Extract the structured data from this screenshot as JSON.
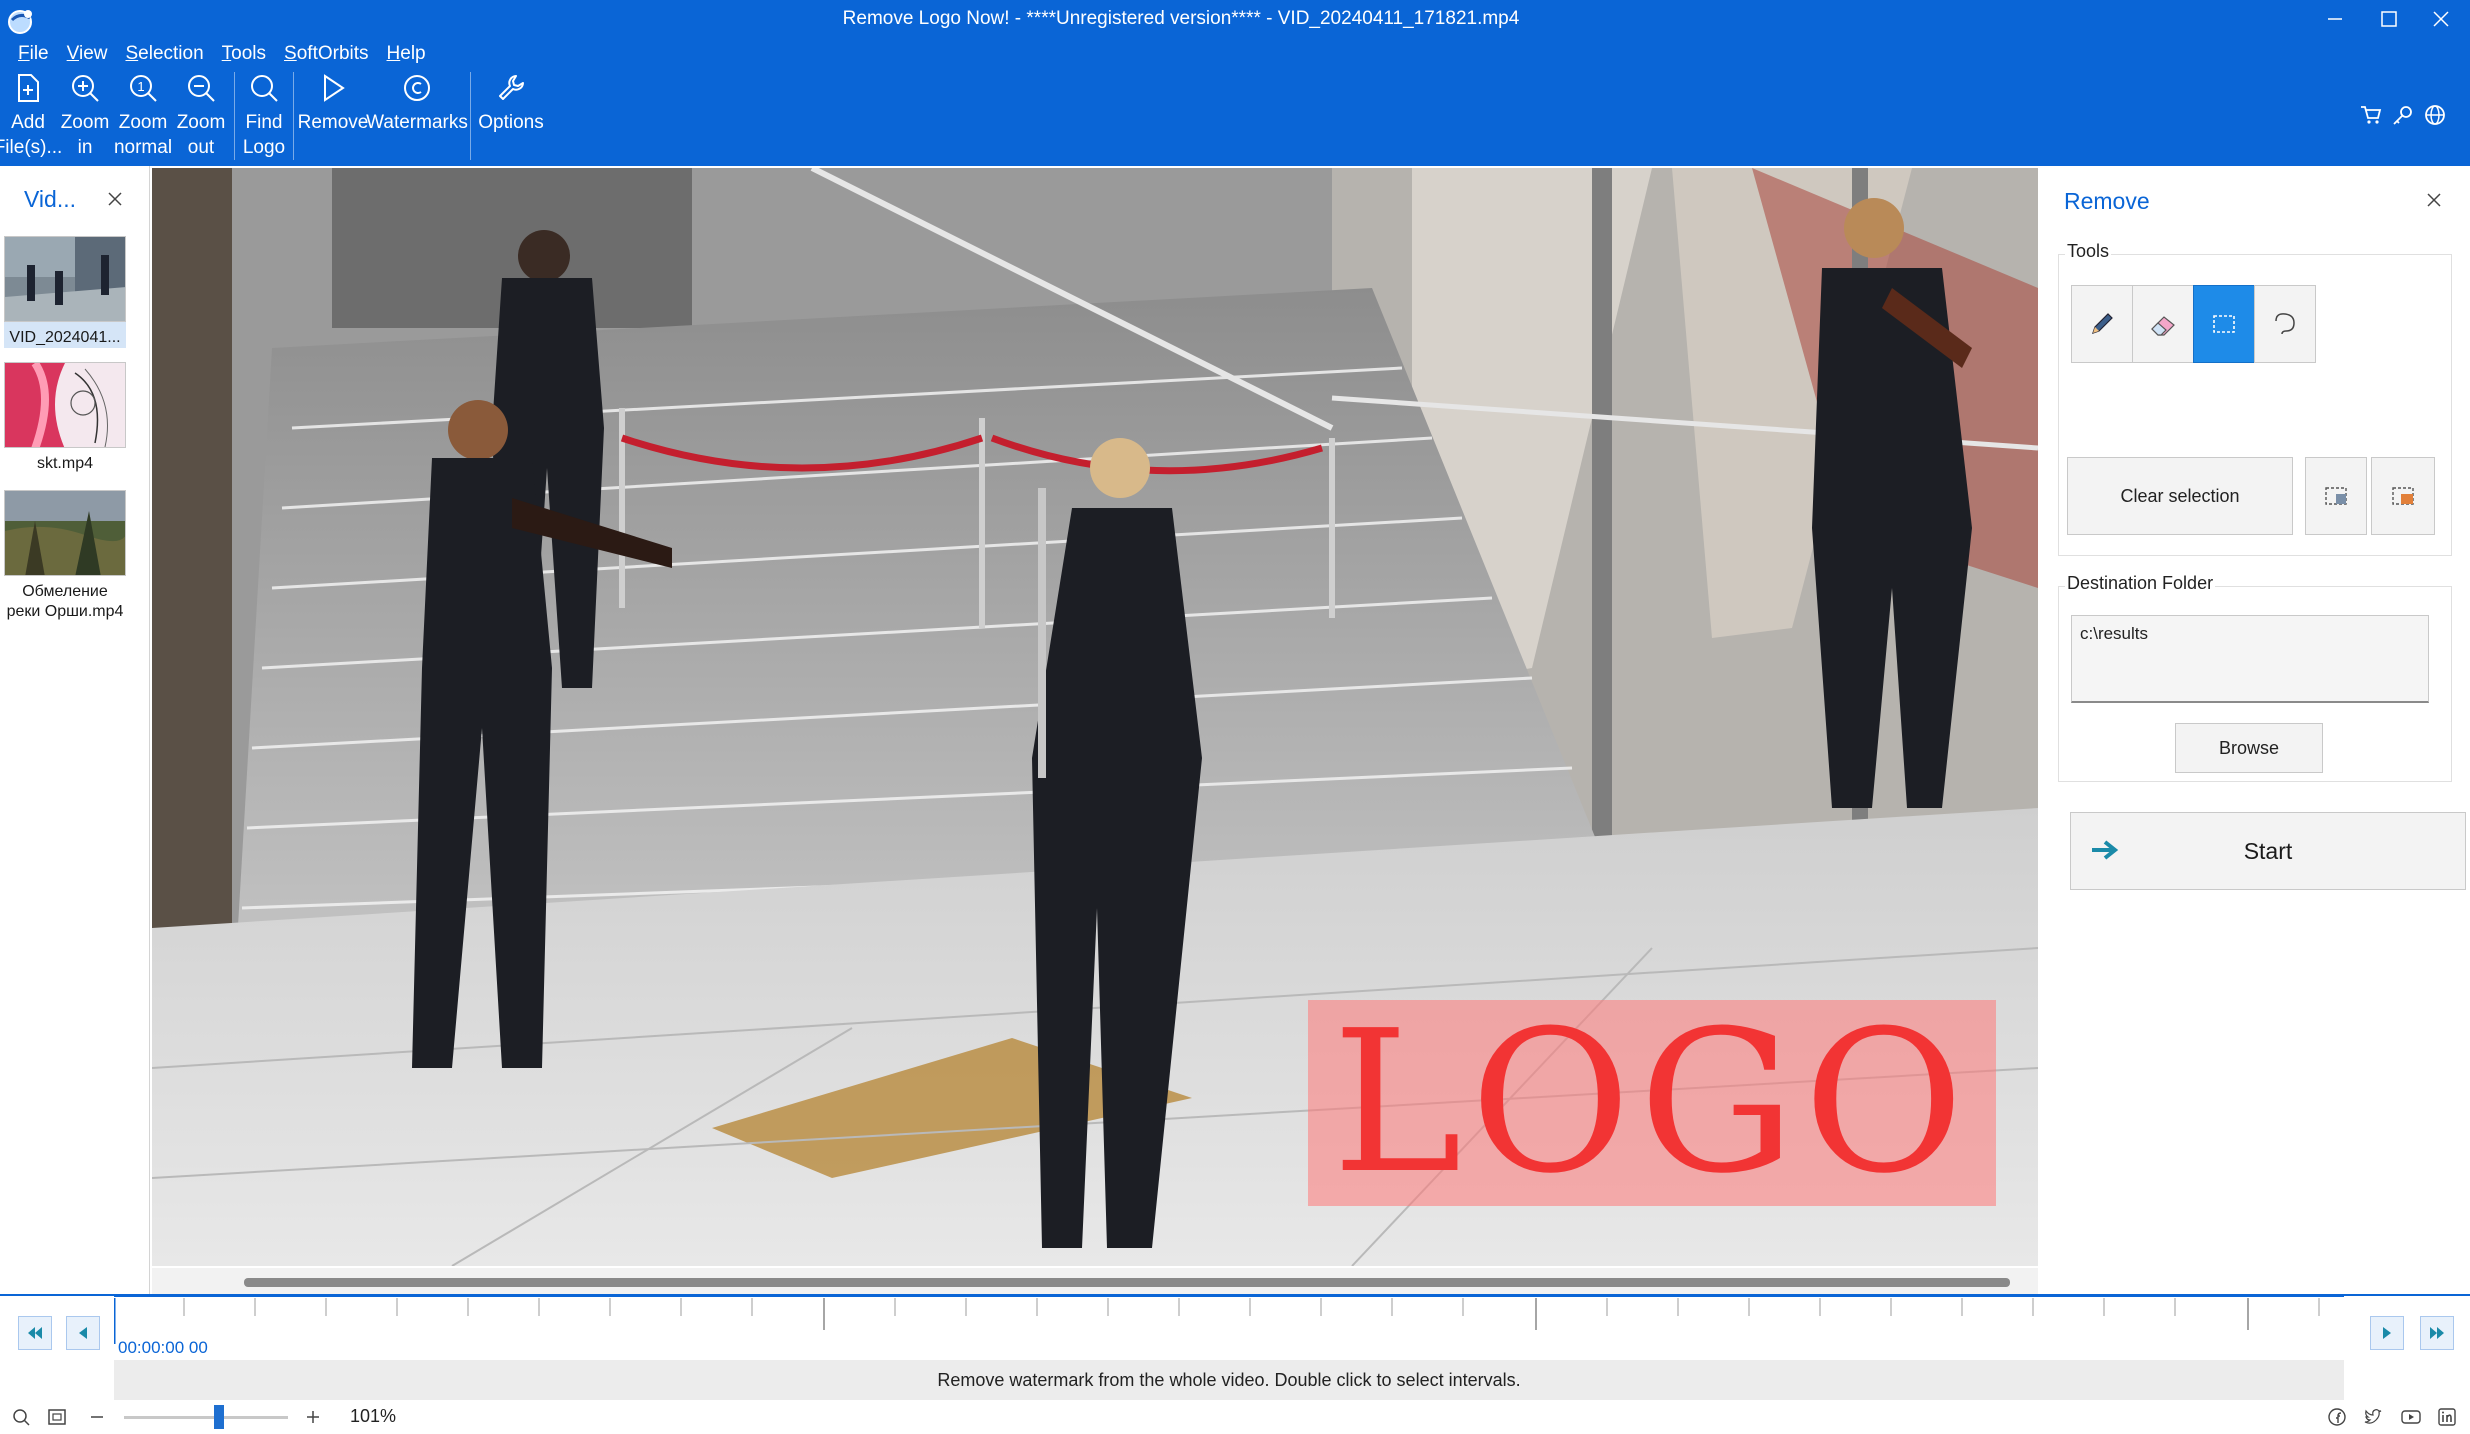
{
  "window": {
    "title": "Remove Logo Now! - ****Unregistered version**** - VID_20240411_171821.mp4"
  },
  "menu": [
    "File",
    "View",
    "Selection",
    "Tools",
    "SoftOrbits",
    "Help"
  ],
  "ribbon": {
    "add_files": "Add\nFile(s)...",
    "zoom_in": "Zoom\nin",
    "zoom_normal": "Zoom\nnormal",
    "zoom_out": "Zoom\nout",
    "find_logo": "Find\nLogo",
    "remove": "Remove",
    "watermarks": "Watermarks",
    "options": "Options"
  },
  "files_panel": {
    "title": "Vid...",
    "items": [
      {
        "name": "VID_2024041...",
        "selected": true
      },
      {
        "name": "skt.mp4",
        "selected": false
      },
      {
        "name": "Обмеление реки Орши.mp4",
        "selected": false
      }
    ]
  },
  "canvas": {
    "overlay_text": "LOGO",
    "overlay_color": "#f23434"
  },
  "remove_panel": {
    "title": "Remove",
    "tools_label": "Tools",
    "tools": [
      "pencil-icon",
      "eraser-icon",
      "rectangle-icon",
      "lasso-icon"
    ],
    "active_tool": "rectangle-icon",
    "clear_selection": "Clear selection",
    "destination_label": "Destination Folder",
    "destination_value": "c:\\results",
    "browse": "Browse",
    "start": "Start"
  },
  "timeline": {
    "time": "00:00:00 00",
    "status": "Remove watermark from the whole video. Double click to select intervals."
  },
  "statusbar": {
    "zoom": "101%",
    "zoom_level": 0.48
  },
  "colors": {
    "accent": "#0a65d6",
    "active_tool": "#1e8be8"
  }
}
